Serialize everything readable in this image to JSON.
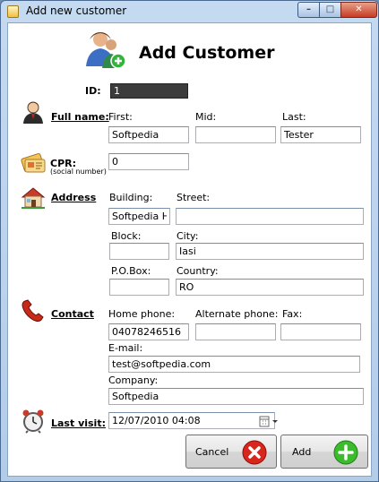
{
  "window": {
    "title": "Add new customer"
  },
  "header": {
    "title": "Add Customer"
  },
  "id": {
    "label": "ID:",
    "value": "1"
  },
  "full_name": {
    "section": "Full name:",
    "first_label": "First:",
    "mid_label": "Mid:",
    "last_label": "Last:",
    "first": "Softpedia",
    "mid": "",
    "last": "Tester"
  },
  "cpr": {
    "section": "CPR:",
    "sub": "(social number)",
    "value": "0"
  },
  "address": {
    "section": "Address",
    "building_label": "Building:",
    "street_label": "Street:",
    "block_label": "Block:",
    "city_label": "City:",
    "pobox_label": "P.O.Box:",
    "country_label": "Country:",
    "building": "Softpedia HQ",
    "street": "",
    "block": "",
    "city": "Iasi",
    "pobox": "",
    "country": "RO"
  },
  "contact": {
    "section": "Contact",
    "home_label": "Home phone:",
    "alt_label": "Alternate phone:",
    "fax_label": "Fax:",
    "email_label": "E-mail:",
    "company_label": "Company:",
    "home": "04078246516",
    "alt": "",
    "fax": "",
    "email": "test@softpedia.com",
    "company": "Softpedia"
  },
  "last_visit": {
    "section": "Last visit:",
    "value": "12/07/2010 04:08"
  },
  "buttons": {
    "cancel": "Cancel",
    "add": "Add"
  },
  "colors": {
    "cancel_icon": "#d9261c",
    "add_icon": "#3cbb2c",
    "title_bar": "#b3cce8"
  }
}
